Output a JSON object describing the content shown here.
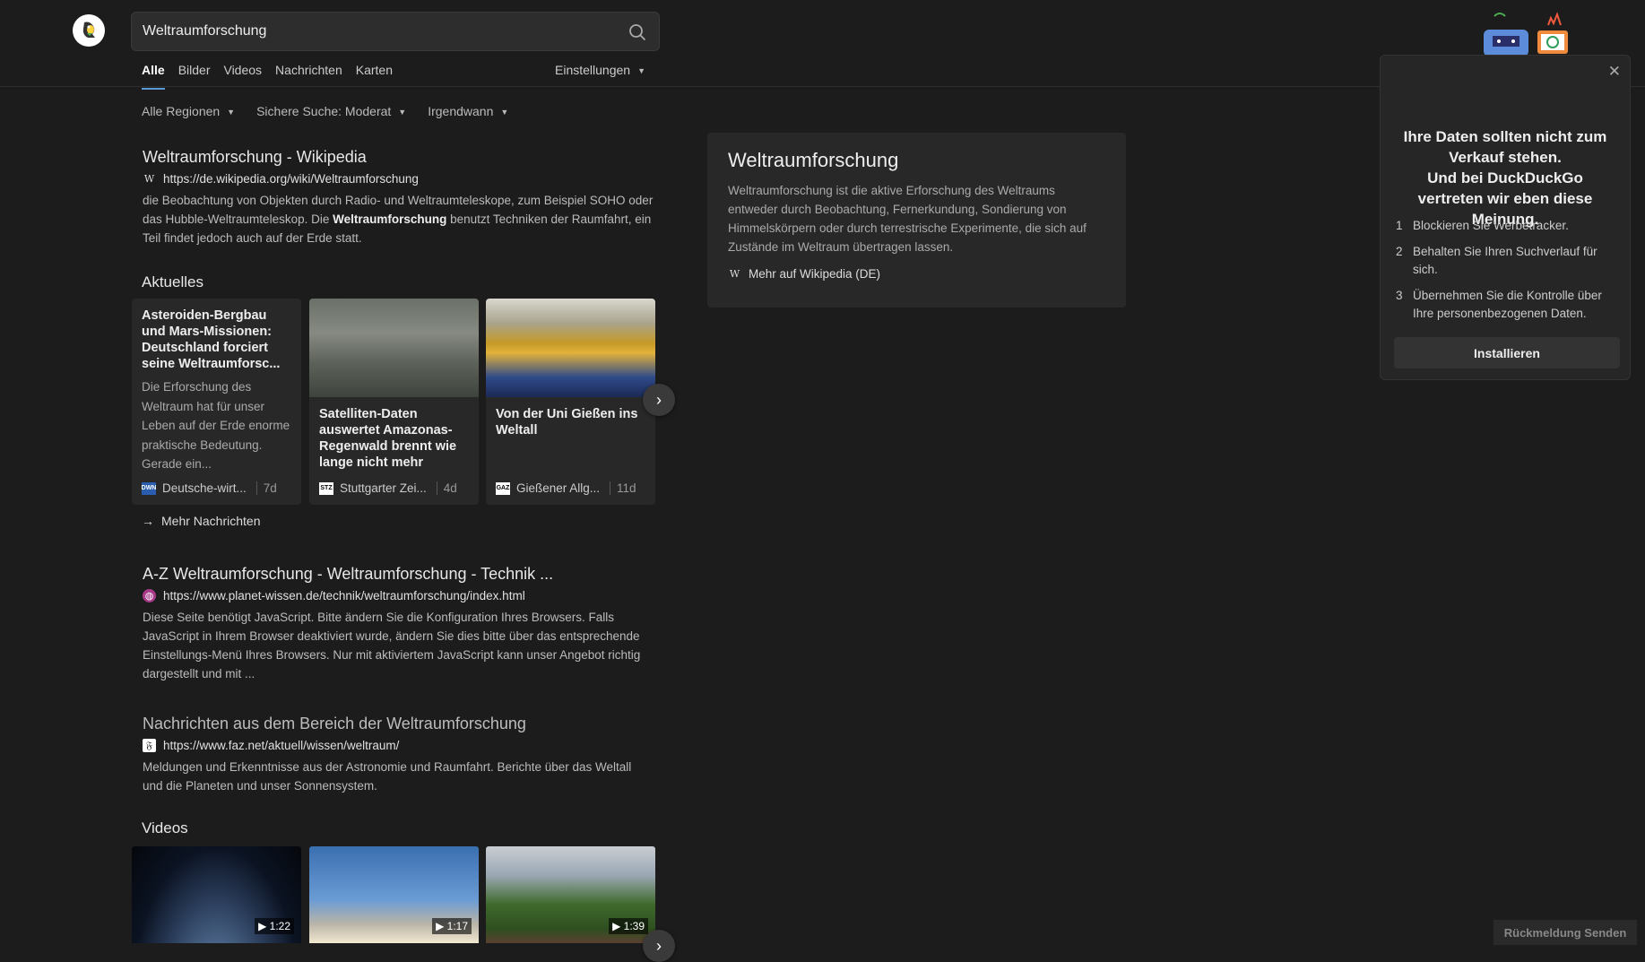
{
  "search": {
    "query": "Weltraumforschung"
  },
  "tabs": [
    {
      "label": "Alle",
      "active": true
    },
    {
      "label": "Bilder"
    },
    {
      "label": "Videos"
    },
    {
      "label": "Nachrichten"
    },
    {
      "label": "Karten"
    }
  ],
  "settings_label": "Einstellungen",
  "filters": {
    "region": "Alle Regionen",
    "safe": "Sichere Suche: Moderat",
    "time": "Irgendwann"
  },
  "results": [
    {
      "title": "Weltraumforschung - Wikipedia",
      "url": "https://de.wikipedia.org/wiki/Weltraumforschung",
      "snippet_pre": "die Beobachtung von Objekten durch Radio- und Weltraumteleskope, zum Beispiel SOHO oder das Hubble-Weltraumteleskop. Die ",
      "snippet_bold": "Weltraumforschung",
      "snippet_post": " benutzt Techniken der Raumfahrt, ein Teil findet jedoch auch auf der Erde statt."
    },
    {
      "title": "A-Z Weltraumforschung - Weltraumforschung - Technik ...",
      "url": "https://www.planet-wissen.de/technik/weltraumforschung/index.html",
      "snippet": "Diese Seite benötigt JavaScript. Bitte ändern Sie die Konfiguration Ihres Browsers. Falls JavaScript in Ihrem Browser deaktiviert wurde, ändern Sie dies bitte über das entsprechende Einstellungs-Menü Ihres Browsers. Nur mit aktiviertem JavaScript kann unser Angebot richtig dargestellt und mit ..."
    },
    {
      "title": "Nachrichten aus dem Bereich der Weltraumforschung",
      "url": "https://www.faz.net/aktuell/wissen/weltraum/",
      "snippet": "Meldungen und Erkenntnisse aus der Astronomie und Raumfahrt. Berichte über das Weltall und die Planeten und unser Sonnensystem."
    }
  ],
  "news_heading": "Aktuelles",
  "news": [
    {
      "title": "Asteroiden-Bergbau und Mars-Missionen: Deutschland forciert seine Weltraumforsc...",
      "snippet": "Die Erforschung des Weltraum hat für unser Leben auf der Erde enorme praktische Bedeutung. Gerade ein...",
      "source": "Deutsche-wirt...",
      "source_icon": "DWN",
      "age": "7d"
    },
    {
      "title": "Satelliten-Daten auswertet Amazonas-Regenwald brennt wie lange nicht mehr",
      "source": "Stuttgarter Zei...",
      "source_icon": "STZ",
      "age": "4d"
    },
    {
      "title": "Von der Uni Gießen ins Weltall",
      "source": "Gießener Allg...",
      "source_icon": "GAZ",
      "age": "11d"
    }
  ],
  "more_news": "Mehr Nachrichten",
  "videos_heading": "Videos",
  "videos": [
    {
      "duration": "1:22"
    },
    {
      "duration": "1:17"
    },
    {
      "duration": "1:39"
    }
  ],
  "knowledge": {
    "title": "Weltraumforschung",
    "snippet": "Weltraumforschung ist die aktive Erforschung des Weltraums entweder durch Beobachtung, Fernerkundung, Sondierung von Himmelskörpern oder durch terrestrische Experimente, die sich auf Zustände im Weltraum übertragen lassen.",
    "more": "Mehr auf Wikipedia (DE)"
  },
  "promo": {
    "title_line1": "Ihre Daten sollten nicht zum Verkauf stehen.",
    "title_line2": "Und bei DuckDuckGo vertreten wir eben diese Meinung.",
    "items": [
      {
        "num": "1",
        "text": "Blockieren Sie Werbetracker."
      },
      {
        "num": "2",
        "text": "Behalten Sie Ihren Suchverlauf für sich."
      },
      {
        "num": "3",
        "text": "Übernehmen Sie die Kontrolle über Ihre personenbezogenen Daten."
      }
    ],
    "install": "Installieren"
  },
  "feedback": "Rückmeldung Senden"
}
